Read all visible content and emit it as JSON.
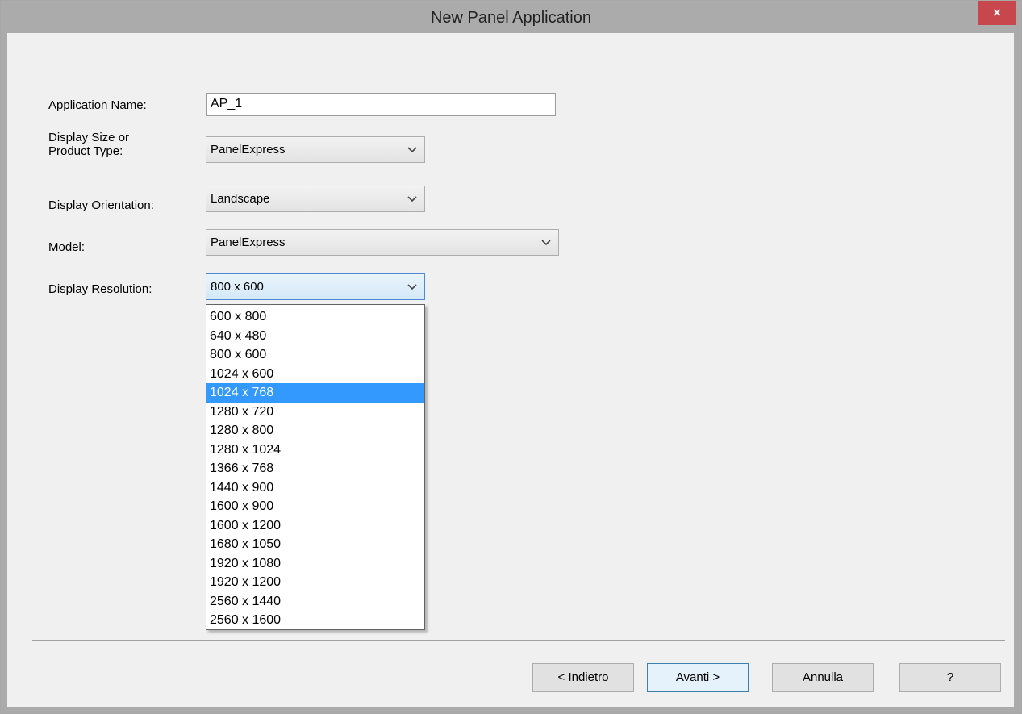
{
  "window": {
    "title": "New Panel Application",
    "close_label": "×"
  },
  "form": {
    "app_name_label": "Application Name:",
    "app_name_value": "AP_1",
    "display_size_label": "Display Size or\nProduct Type:",
    "display_size_value": "PanelExpress",
    "orientation_label": "Display Orientation:",
    "orientation_value": "Landscape",
    "model_label": "Model:",
    "model_value": "PanelExpress",
    "resolution_label": "Display Resolution:",
    "resolution_value": "800 x 600"
  },
  "resolution_options": [
    "600 x 800",
    "640 x 480",
    "800 x 600",
    "1024 x 600",
    "1024 x 768",
    "1280 x 720",
    "1280 x 800",
    "1280 x 1024",
    "1366 x 768",
    "1440 x 900",
    "1600 x 900",
    "1600 x 1200",
    "1680 x 1050",
    "1920 x 1080",
    "1920 x 1200",
    "2560 x 1440",
    "2560 x 1600"
  ],
  "highlighted_option": "1024 x 768",
  "buttons": {
    "back": "< Indietro",
    "next": "Avanti >",
    "cancel": "Annulla",
    "help": "?"
  },
  "colors": {
    "close_button": "#c7474c",
    "selection": "#3399ff",
    "titlebar": "#ababab",
    "dialog_background": "#f0f0f0"
  },
  "icons": {
    "dropdown_arrow": "chevron-down-icon"
  }
}
